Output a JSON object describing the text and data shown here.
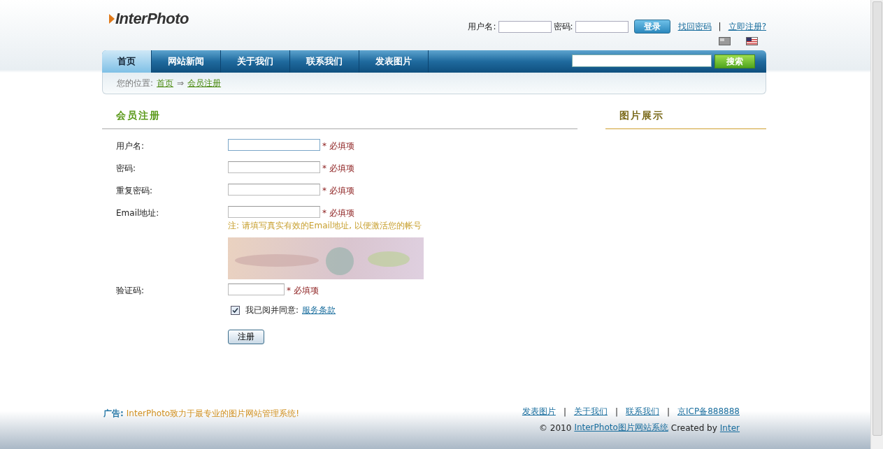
{
  "logo": {
    "text": "InterPhoto"
  },
  "login": {
    "username_label": "用户名:",
    "password_label": "密码:",
    "button": "登录",
    "links": [
      "找回密码",
      "立即注册?"
    ],
    "separator": "|"
  },
  "nav": {
    "items": [
      {
        "label": "首页",
        "selected": true
      },
      {
        "label": "网站新闻",
        "selected": false
      },
      {
        "label": "关于我们",
        "selected": false
      },
      {
        "label": "联系我们",
        "selected": false
      },
      {
        "label": "发表图片",
        "selected": false
      }
    ],
    "search_button": "搜索"
  },
  "breadcrumb": {
    "label": "您的位置:",
    "items": [
      "首页",
      "会员注册"
    ],
    "separator": "⇒"
  },
  "form": {
    "title": "会员注册",
    "fields": [
      {
        "label": "用户名:",
        "kind": "text",
        "required": "* 必填项",
        "focused": true
      },
      {
        "label": "密码:",
        "kind": "text",
        "required": "* 必填项",
        "focused": false
      },
      {
        "label": "重复密码:",
        "kind": "text",
        "required": "* 必填项",
        "focused": false
      },
      {
        "label": "Email地址:",
        "kind": "text",
        "required": "* 必填项",
        "focused": false,
        "note": "注: 请填写真实有效的Email地址, 以便激活您的帐号"
      },
      {
        "label": "验证码:",
        "kind": "captcha",
        "required": "* 必填项",
        "focused": false
      }
    ],
    "agree": {
      "checked": true,
      "text": "我已阅并同意:",
      "link": "服务条款"
    },
    "submit": "注册"
  },
  "sidebar": {
    "title": "图片展示"
  },
  "footer": {
    "ad_label": "广告:",
    "ad_text": "InterPhoto致力于最专业的图片网站管理系统!",
    "links": [
      "发表图片",
      "关于我们",
      "联系我们",
      "京ICP备888888"
    ],
    "separator": "|",
    "copyright": "© 2010",
    "site_link": "InterPhoto图片网站系统",
    "created_by": "Created by",
    "author_link": "Inter"
  }
}
